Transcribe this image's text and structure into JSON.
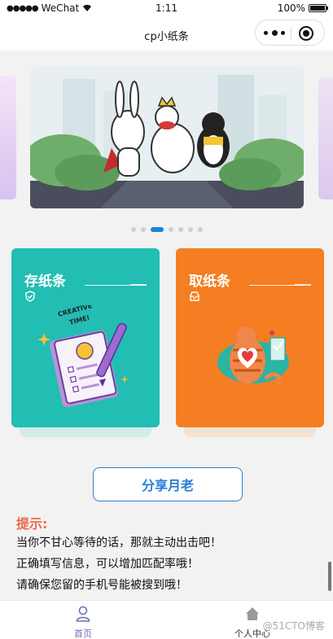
{
  "status_bar": {
    "carrier": "WeChat",
    "time": "1:11",
    "battery_text": "100%"
  },
  "nav": {
    "title": "cp小纸条"
  },
  "carousel": {
    "dot_count": 7,
    "active_index": 2
  },
  "cards": [
    {
      "title": "存纸条",
      "icon": "shield-check-icon",
      "color": "#22bdb3"
    },
    {
      "title": "取纸条",
      "icon": "inbox-icon",
      "color": "#f47e21"
    }
  ],
  "share_button": {
    "label": "分享月老"
  },
  "tips": {
    "title": "提示:",
    "lines": [
      "当你不甘心等待的话，那就主动出击吧！",
      "正确填写信息，可以增加匹配率哦！",
      "请确保您留的手机号能被搜到哦！"
    ]
  },
  "tab_bar": {
    "items": [
      {
        "label": "首页",
        "icon": "user-icon",
        "active": true
      },
      {
        "label": "个人中心",
        "icon": "house-icon",
        "active": false
      }
    ]
  },
  "watermark": "@51CTO博客",
  "colors": {
    "accent_blue": "#2a7fd6",
    "tips_red": "#ea6a4b",
    "tab_active": "#6b6fb8"
  }
}
